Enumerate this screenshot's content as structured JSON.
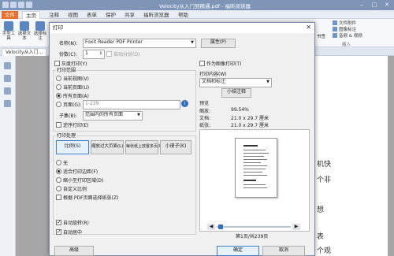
{
  "window": {
    "title": "Velocity从入门到精通.pdf - 福昕阅读器",
    "tabs": [
      "文件",
      "主页",
      "注释",
      "视图",
      "表单",
      "保护",
      "共享",
      "福昕浏览器",
      "帮助"
    ],
    "doc_tab": "Velocity从入门..."
  },
  "ribbon": {
    "items": [
      "手型工具",
      "选择文本",
      "选择标注"
    ],
    "side_items": [
      "文件附件",
      "图像标注",
      "音频 & 视频"
    ],
    "side_group": "插入",
    "right_label": "书签"
  },
  "page_text": [
    "机快",
    "个非",
    "想",
    "表",
    "个观"
  ],
  "dialog": {
    "title": "打印",
    "printer_label": "名称(N):",
    "printer_value": "Foxit Reader PDF Printer",
    "properties_btn": "属性(P)",
    "copies_label": "份数(C):",
    "copies_value": "1",
    "collate_label": "自动分份(O)",
    "grayscale_label": "灰度打印(Y)",
    "print_as_image_label": "作为图像打印(T)",
    "range_group": "打印范围",
    "range_current_view": "当前视图(V)",
    "range_current_page": "当前页面(U)",
    "range_all_pages": "所有页面(A)",
    "range_pages": "页面(G):",
    "range_pages_hint": "1-239",
    "subset_label": "子集(B):",
    "subset_value": "范围内的所有页面",
    "reverse_label": "逆序打印(E)",
    "content_group": "打印内容(W)",
    "content_value": "文档和标注",
    "summarize_btn": "小结注释",
    "handling_group": "打印处理",
    "handling_buttons": [
      "比例(S)",
      "缩放过大页面(L)",
      "每张纸上放置多页(M)",
      "小册子(K)"
    ],
    "scale_none": "无",
    "scale_fit_print": "适合打印边距(F)",
    "scale_shrink": "缩小至打印区域(D)",
    "scale_custom": "自定义比例",
    "scale_paper_source": "根据 PDF页面选择纸张(Z)",
    "auto_rotate": "自动旋转(R)",
    "auto_center": "自动居中",
    "preview_group": "预览",
    "zoom_label": "缩放:",
    "zoom_value": "99.54%",
    "doc_label": "文档:",
    "doc_value": "21.0 x 29.7 厘米",
    "paper_label": "纸张:",
    "paper_value": "21.0 x 29.7 厘米",
    "page_nav": "第1页/共239页",
    "advanced_btn": "高级",
    "ok_btn": "确定",
    "cancel_btn": "取消"
  }
}
